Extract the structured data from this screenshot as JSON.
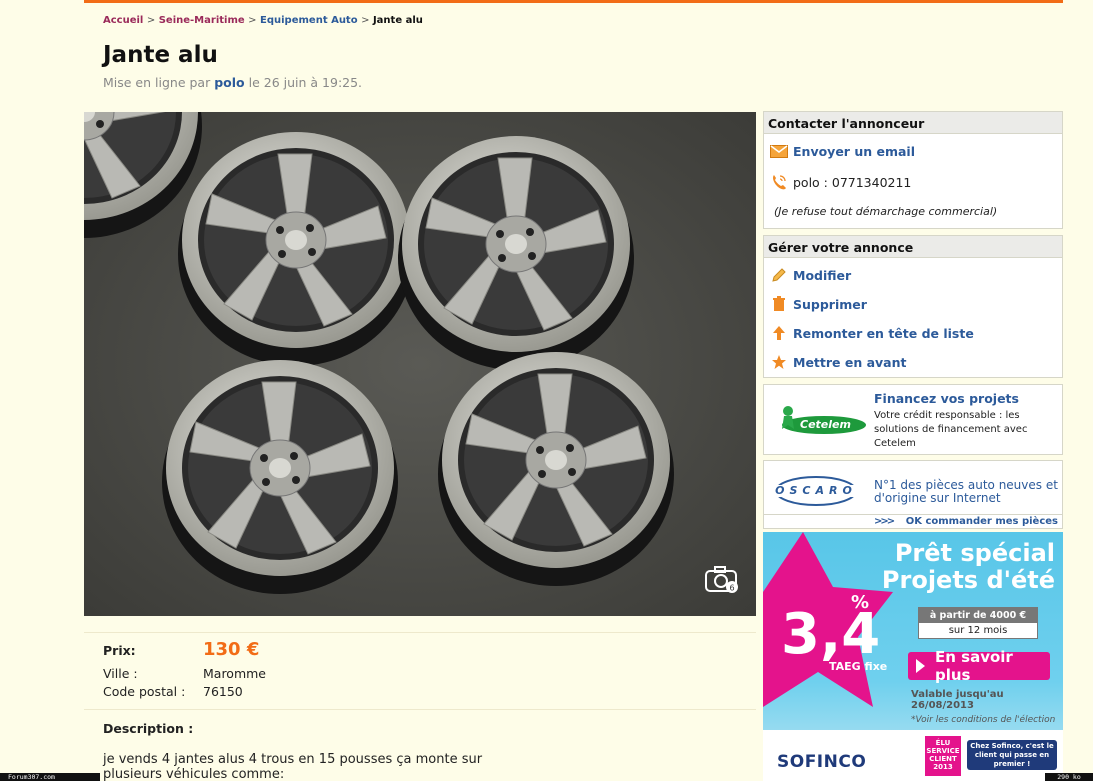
{
  "breadcrumb": {
    "home": "Accueil",
    "sep": ">",
    "region": "Seine-Maritime",
    "category": "Equipement Auto",
    "current": "Jante alu"
  },
  "ad": {
    "title": "Jante alu",
    "posted_prefix": "Mise en ligne par",
    "author": "polo",
    "posted_suffix": "le 26 juin à 19:25."
  },
  "details": {
    "price_label": "Prix:",
    "price_value": "130 €",
    "city_label": "Ville :",
    "city_value": "Maromme",
    "zip_label": "Code postal :",
    "zip_value": "76150",
    "description_label": "Description :",
    "description_text": "je vends 4 jantes alus 4 trous en 15 pousses ça monte sur plusieurs véhicules comme:"
  },
  "contact": {
    "header": "Contacter l'annonceur",
    "email_label": "Envoyer un email",
    "phone_text": "polo : 0771340211",
    "note": "(Je refuse tout démarchage commercial)"
  },
  "manage": {
    "header": "Gérer votre annonce",
    "edit": "Modifier",
    "delete": "Supprimer",
    "bump": "Remonter en tête de liste",
    "feature": "Mettre en avant"
  },
  "cetelem": {
    "logo": "Cetelem",
    "title": "Financez vos projets",
    "text": "Votre crédit responsable : les solutions de financement avec Cetelem"
  },
  "oscaro": {
    "logo": "OSCARO",
    "text": "N°1 des pièces auto neuves et d'origine sur Internet",
    "link_arrows": ">>>",
    "link": "OK commander mes pièces"
  },
  "sofinco": {
    "title_line1": "Prêt spécial",
    "title_line2": "Projets d'été",
    "rate": "3,4",
    "pct": "%",
    "taeg": "TAEG fixe",
    "from": "à partir de 4000 €",
    "duration": "sur  12 mois",
    "cta": "En savoir plus",
    "valid": "Valable jusqu'au 26/08/2013",
    "conditions": "*Voir les conditions de l'élection",
    "brand": "SOFINCO",
    "award": "ÉLU SERVICE CLIENT 2013",
    "slogan": "Chez Sofinco, c'est le client qui passe en premier !"
  },
  "footer": {
    "left": "Forum307.com",
    "right": "290 ko"
  },
  "colors": {
    "accent_orange": "#f26c16",
    "link_blue": "#2c5a9a",
    "breadcrumb_purple": "#9a2a5a",
    "background": "#fefde8"
  }
}
